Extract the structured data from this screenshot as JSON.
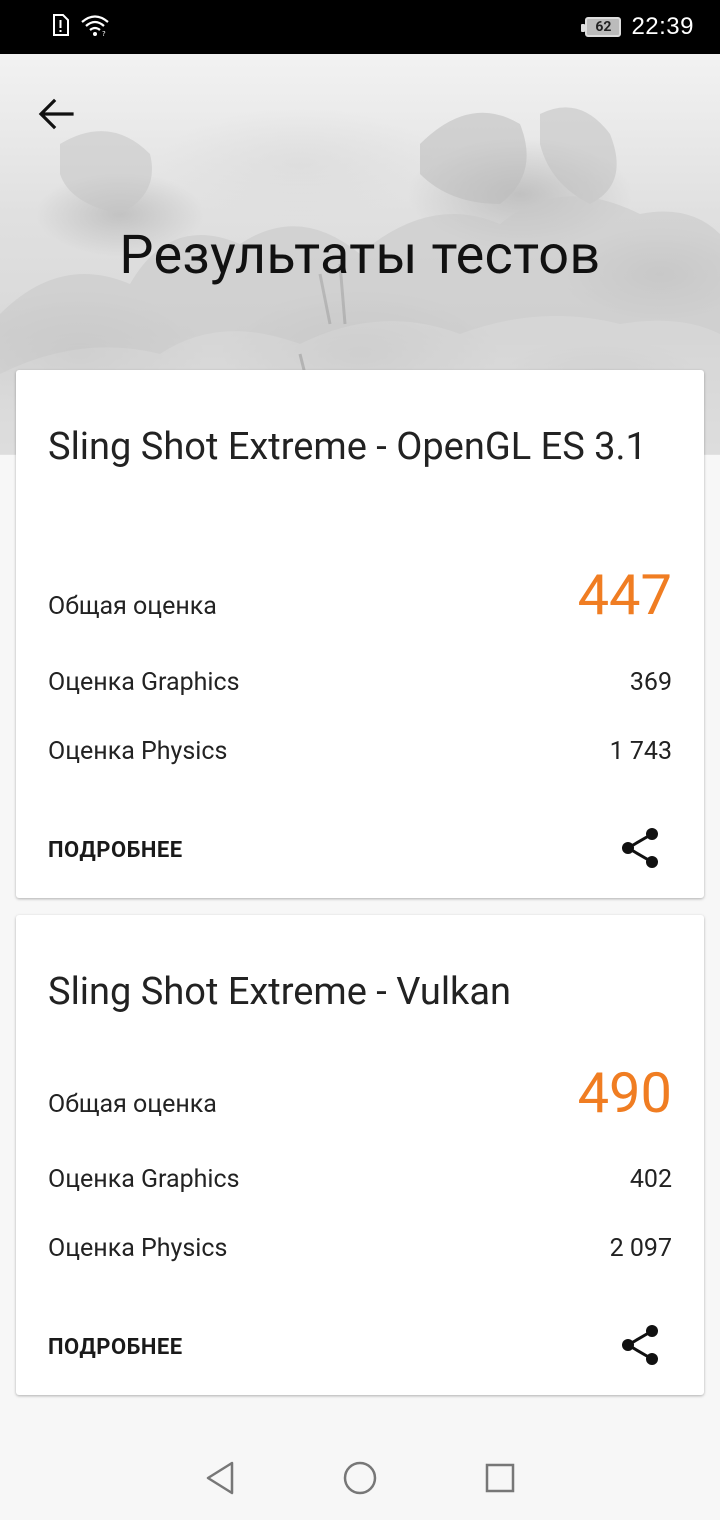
{
  "status_bar": {
    "time": "22:39",
    "battery_level": "62",
    "icons": [
      "sim-alert-icon",
      "wifi-icon",
      "battery-icon"
    ]
  },
  "header": {
    "back_icon": "arrow-left-icon",
    "title": "Результаты тестов"
  },
  "colors": {
    "accent": "#f07d22",
    "text": "#222222"
  },
  "results": [
    {
      "title": "Sling Shot Extreme - OpenGL ES 3.1",
      "total_label": "Общая оценка",
      "total_value": "447",
      "graphics_label": "Оценка Graphics",
      "graphics_value": "369",
      "physics_label": "Оценка Physics",
      "physics_value": "1 743",
      "details_label": "ПОДРОБНЕЕ",
      "share_icon": "share-icon"
    },
    {
      "title": "Sling Shot Extreme - Vulkan",
      "total_label": "Общая оценка",
      "total_value": "490",
      "graphics_label": "Оценка Graphics",
      "graphics_value": "402",
      "physics_label": "Оценка Physics",
      "physics_value": "2 097",
      "details_label": "ПОДРОБНЕЕ",
      "share_icon": "share-icon"
    }
  ],
  "nav_bar": {
    "icons": [
      "nav-back-icon",
      "nav-home-icon",
      "nav-recents-icon"
    ]
  }
}
